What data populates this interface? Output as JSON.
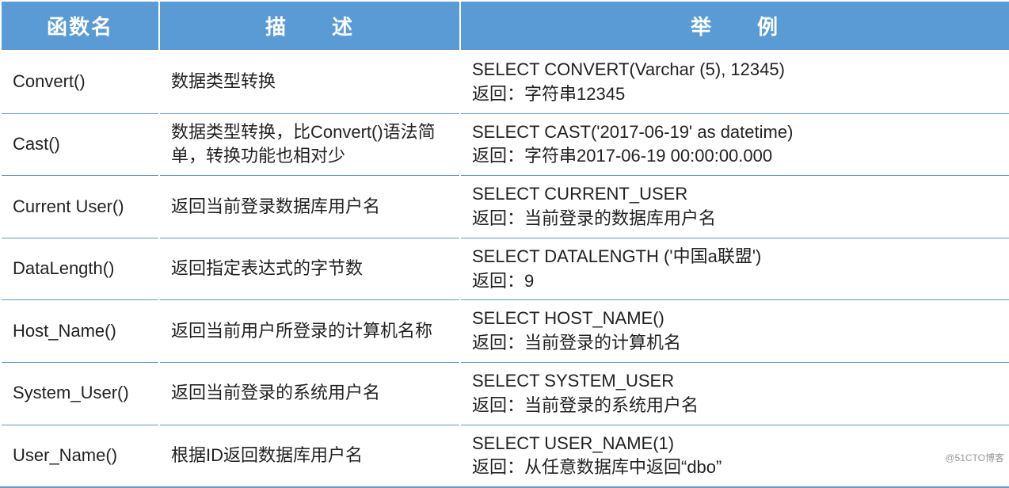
{
  "headers": {
    "name": "函数名",
    "desc": "描　　述",
    "example": "举　　例"
  },
  "rows": [
    {
      "name": "Convert()",
      "desc": "数据类型转换",
      "ex1": "SELECT CONVERT(Varchar (5), 12345)",
      "ex2": "返回：字符串12345"
    },
    {
      "name": "Cast()",
      "desc": "数据类型转换，比Convert()语法简单，转换功能也相对少",
      "ex1": "SELECT CAST('2017-06-19'   as datetime)",
      "ex2": "返回：字符串2017-06-19 00:00:00.000"
    },
    {
      "name": "Current User()",
      "desc": "返回当前登录数据库用户名",
      "ex1": "SELECT CURRENT_USER",
      "ex2": "返回：当前登录的数据库用户名"
    },
    {
      "name": "DataLength()",
      "desc": "返回指定表达式的字节数",
      "ex1": "SELECT DATALENGTH ('中国a联盟')",
      "ex2": "返回：9"
    },
    {
      "name": "Host_Name()",
      "desc": "返回当前用户所登录的计算机名称",
      "ex1": "SELECT HOST_NAME()",
      "ex2": "返回：当前登录的计算机名"
    },
    {
      "name": "System_User()",
      "desc": "返回当前登录的系统用户名",
      "ex1": "SELECT SYSTEM_USER",
      "ex2": "返回：当前登录的系统用户名"
    },
    {
      "name": "User_Name()",
      "desc": "根据ID返回数据库用户名",
      "ex1": "SELECT USER_NAME(1)",
      "ex2": "返回：从任意数据库中返回“dbo”"
    }
  ],
  "watermark": "@51CTO博客",
  "chart_data": {
    "type": "table",
    "columns": [
      "函数名",
      "描述",
      "举例"
    ],
    "rows": [
      [
        "Convert()",
        "数据类型转换",
        "SELECT CONVERT(Varchar (5), 12345) 返回：字符串12345"
      ],
      [
        "Cast()",
        "数据类型转换，比Convert()语法简单，转换功能也相对少",
        "SELECT CAST('2017-06-19' as datetime) 返回：字符串2017-06-19 00:00:00.000"
      ],
      [
        "Current User()",
        "返回当前登录数据库用户名",
        "SELECT CURRENT_USER 返回：当前登录的数据库用户名"
      ],
      [
        "DataLength()",
        "返回指定表达式的字节数",
        "SELECT DATALENGTH ('中国a联盟') 返回：9"
      ],
      [
        "Host_Name()",
        "返回当前用户所登录的计算机名称",
        "SELECT HOST_NAME() 返回：当前登录的计算机名"
      ],
      [
        "System_User()",
        "返回当前登录的系统用户名",
        "SELECT SYSTEM_USER 返回：当前登录的系统用户名"
      ],
      [
        "User_Name()",
        "根据ID返回数据库用户名",
        "SELECT USER_NAME(1) 返回：从任意数据库中返回“dbo”"
      ]
    ]
  }
}
